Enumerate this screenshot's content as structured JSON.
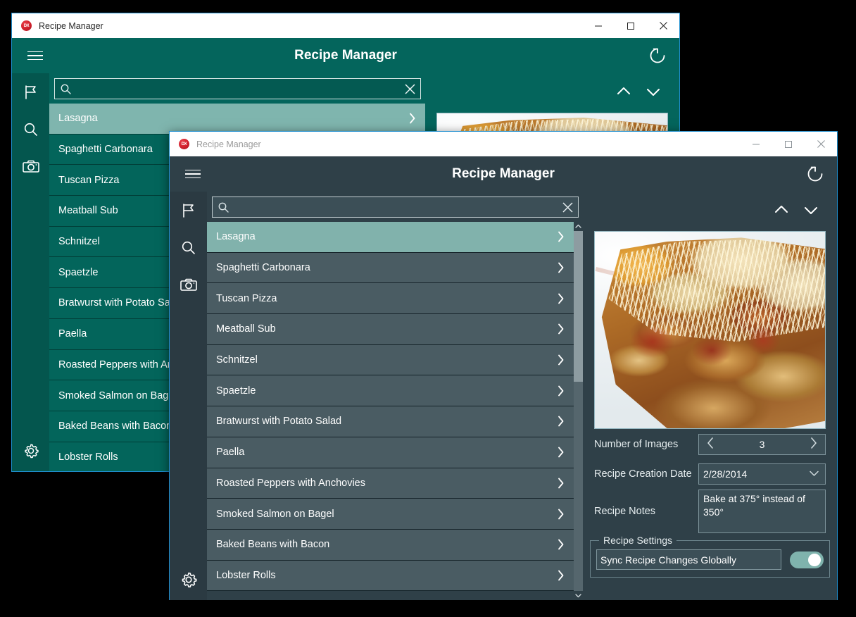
{
  "back_window": {
    "titlebar": {
      "logo": "dx-logo",
      "title": "Recipe Manager",
      "minimize": "minimize-icon",
      "maximize": "maximize-icon",
      "close": "close-icon"
    },
    "header": {
      "menu_icon": "hamburger-icon",
      "title": "Recipe Manager",
      "refresh_icon": "refresh-icon"
    },
    "rail": {
      "items": [
        {
          "icon": "flag-icon",
          "name": "flag"
        },
        {
          "icon": "search-icon",
          "name": "search"
        },
        {
          "icon": "camera-icon",
          "name": "camera"
        }
      ],
      "settings_icon": "gear-icon"
    },
    "search": {
      "value": "",
      "placeholder": "",
      "icon": "search-icon",
      "clear_icon": "clear-icon"
    },
    "recipes": [
      {
        "name": "Lasagna",
        "selected": true
      },
      {
        "name": "Spaghetti Carbonara",
        "selected": false
      },
      {
        "name": "Tuscan Pizza",
        "selected": false
      },
      {
        "name": "Meatball Sub",
        "selected": false
      },
      {
        "name": "Schnitzel",
        "selected": false
      },
      {
        "name": "Spaetzle",
        "selected": false
      },
      {
        "name": "Bratwurst with Potato Salad",
        "selected": false
      },
      {
        "name": "Paella",
        "selected": false
      },
      {
        "name": "Roasted Peppers with Anchovies",
        "selected": false
      },
      {
        "name": "Smoked Salmon on Bagel",
        "selected": false
      },
      {
        "name": "Baked Beans with Bacon",
        "selected": false
      },
      {
        "name": "Lobster Rolls",
        "selected": false
      }
    ],
    "detail": {
      "prev_icon": "chevron-up-icon",
      "next_icon": "chevron-down-icon",
      "photo": "lasagna-photo"
    }
  },
  "front_window": {
    "titlebar": {
      "logo": "dx-logo",
      "title": "Recipe Manager",
      "minimize": "minimize-icon",
      "maximize": "maximize-icon",
      "close": "close-icon"
    },
    "header": {
      "menu_icon": "hamburger-icon",
      "title": "Recipe Manager",
      "refresh_icon": "refresh-icon"
    },
    "rail": {
      "items": [
        {
          "icon": "flag-icon",
          "name": "flag"
        },
        {
          "icon": "search-icon",
          "name": "search"
        },
        {
          "icon": "camera-icon",
          "name": "camera"
        }
      ],
      "settings_icon": "gear-icon"
    },
    "search": {
      "value": "",
      "placeholder": "",
      "icon": "search-icon",
      "clear_icon": "clear-icon"
    },
    "recipes": [
      {
        "name": "Lasagna",
        "selected": true
      },
      {
        "name": "Spaghetti Carbonara",
        "selected": false
      },
      {
        "name": "Tuscan Pizza",
        "selected": false
      },
      {
        "name": "Meatball Sub",
        "selected": false
      },
      {
        "name": "Schnitzel",
        "selected": false
      },
      {
        "name": "Spaetzle",
        "selected": false
      },
      {
        "name": "Bratwurst with Potato Salad",
        "selected": false
      },
      {
        "name": "Paella",
        "selected": false
      },
      {
        "name": "Roasted Peppers with Anchovies",
        "selected": false
      },
      {
        "name": "Smoked Salmon on Bagel",
        "selected": false
      },
      {
        "name": "Baked Beans with Bacon",
        "selected": false
      },
      {
        "name": "Lobster Rolls",
        "selected": false
      }
    ],
    "detail": {
      "prev_icon": "chevron-up-icon",
      "next_icon": "chevron-down-icon",
      "photo": "lasagna-photo",
      "fields": {
        "images_label": "Number of Images",
        "images_value": "3",
        "images_prev_icon": "chevron-left-icon",
        "images_next_icon": "chevron-right-icon",
        "date_label": "Recipe Creation Date",
        "date_value": "2/28/2014",
        "date_dropdown_icon": "chevron-down-icon",
        "notes_label": "Recipe Notes",
        "notes_value": "Bake at 375° instead of 350°"
      },
      "settings_group": {
        "title": "Recipe Settings",
        "sync_label": "Sync Recipe Changes Globally",
        "sync_enabled": "on"
      }
    }
  },
  "colors": {
    "back_accent": "#04655C",
    "front_accent": "#2F4048",
    "selection": "#81B2AC",
    "window_border": "#1F8FD0",
    "toggle_on": "#7FB3AD",
    "logo_red": "#D0202C"
  }
}
